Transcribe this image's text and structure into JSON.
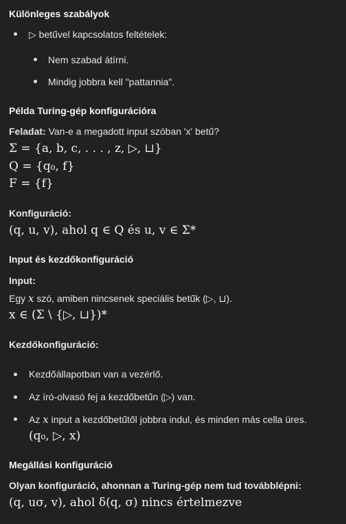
{
  "sections": {
    "special_rules": {
      "heading": "Különleges szabályok",
      "item1": "▷ betűvel kapcsolatos feltételek:",
      "sub1": "Nem szabad átírni.",
      "sub2": "Mindig jobbra kell \"pattannia\"."
    },
    "example": {
      "heading": "Példa Turing-gép konfigurációra",
      "task_label": "Feladat:",
      "task_text": " Van-e a megadott input szóban 'x' betű?",
      "sigma": "Σ = {a, b, c, . . . , z, ▷, ⊔}",
      "Q": "Q = {q₀, f}",
      "F": "F = {f}",
      "config_label": "Konfiguráció:",
      "config_formula": "(q, u, v),  ahol q ∈ Q és u, v ∈ Σ*"
    },
    "input_start": {
      "heading": "Input és kezdőkonfiguráció",
      "input_label": "Input:",
      "input_text_a": "Egy ",
      "input_var": "x",
      "input_text_b": " szó, amiben nincsenek speciális betűk (▷, ⊔).",
      "input_formula": "x ∈ (Σ \\ {▷, ⊔})*",
      "start_label": "Kezdőkonfiguráció:",
      "bullet1": "Kezdőállapotban van a vezérlő.",
      "bullet2": "Az író-olvasó fej a kezdőbetűn (▷) van.",
      "bullet3_a": "Az ",
      "bullet3_var": "x",
      "bullet3_b": " input a kezdőbetűtől jobbra indul, és minden más cella üres.",
      "bullet3_formula": "(q₀, ▷, x)"
    },
    "halting": {
      "heading": "Megállási konfiguráció",
      "desc": "Olyan konfiguráció, ahonnan a Turing-gép nem tud továbblépni:",
      "formula": "(q, uσ, v),  ahol δ(q, σ) nincs értelmezve"
    }
  }
}
